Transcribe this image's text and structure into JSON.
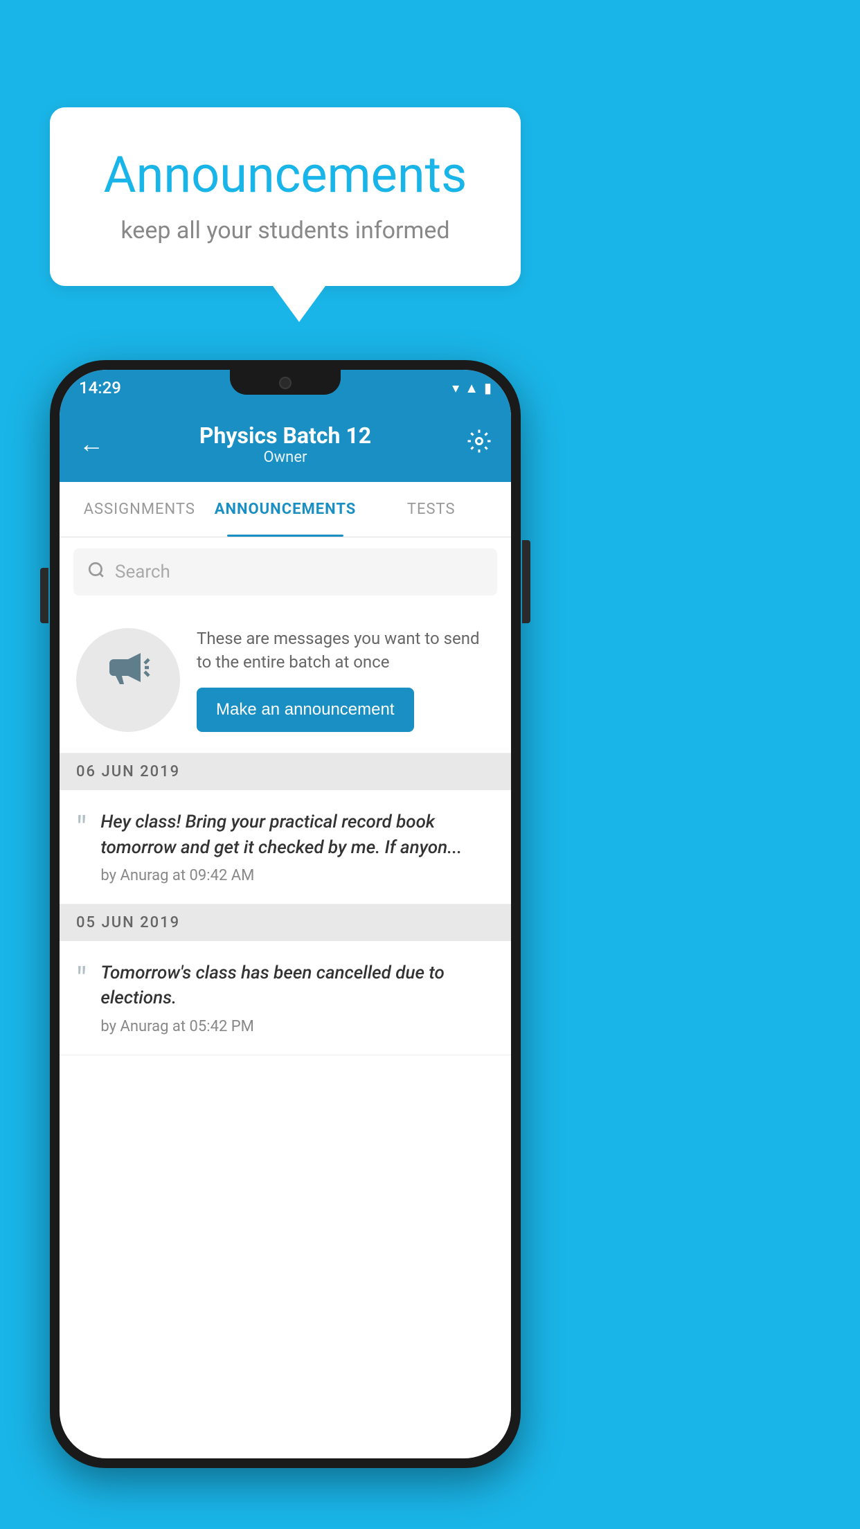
{
  "page": {
    "background_color": "#1ab5e8"
  },
  "speech_bubble": {
    "title": "Announcements",
    "subtitle": "keep all your students informed"
  },
  "phone": {
    "status_bar": {
      "time": "14:29"
    },
    "app_bar": {
      "title": "Physics Batch 12",
      "subtitle": "Owner",
      "back_label": "←"
    },
    "tabs": [
      {
        "label": "ASSIGNMENTS",
        "active": false
      },
      {
        "label": "ANNOUNCEMENTS",
        "active": true
      },
      {
        "label": "TESTS",
        "active": false
      }
    ],
    "search": {
      "placeholder": "Search"
    },
    "announcement_prompt": {
      "description": "These are messages you want to send to the entire batch at once",
      "button_label": "Make an announcement"
    },
    "announcements": [
      {
        "date": "06  JUN  2019",
        "text": "Hey class! Bring your practical record book tomorrow and get it checked by me. If anyon...",
        "meta": "by Anurag at 09:42 AM"
      },
      {
        "date": "05  JUN  2019",
        "text": "Tomorrow's class has been cancelled due to elections.",
        "meta": "by Anurag at 05:42 PM"
      }
    ]
  }
}
